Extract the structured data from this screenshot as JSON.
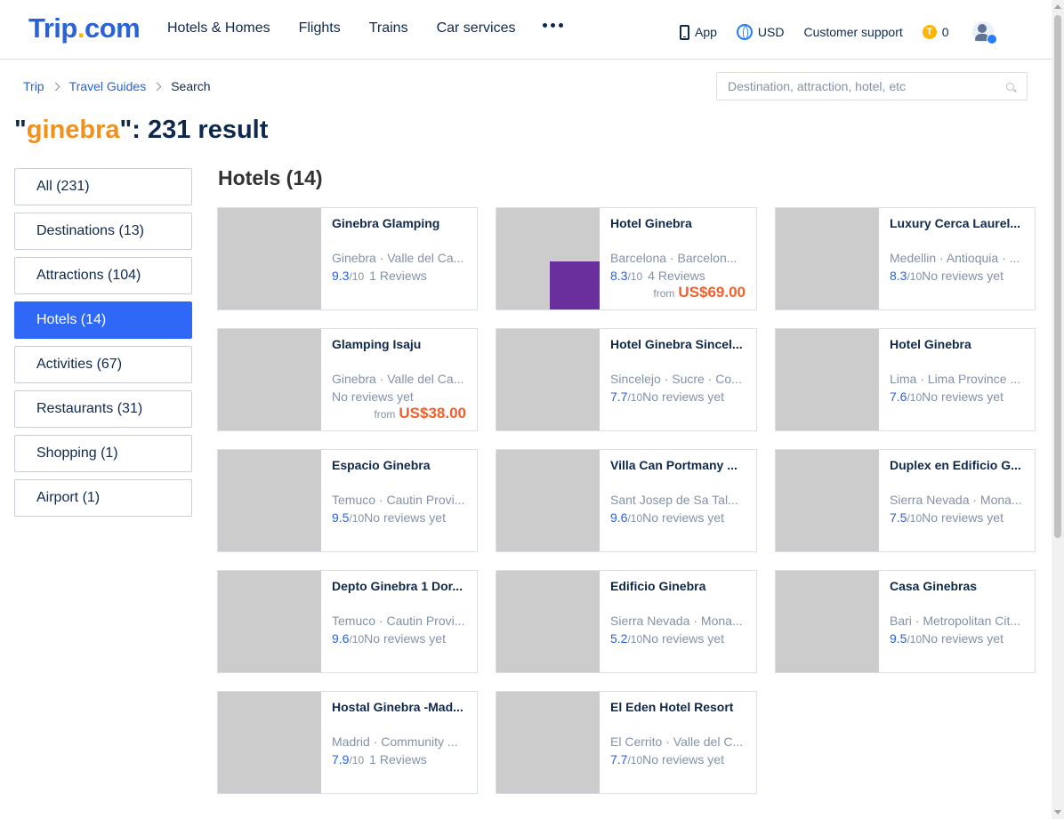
{
  "header": {
    "logo_main": "Trip",
    "logo_dot": ".",
    "logo_tld": "com",
    "nav": [
      "Hotels & Homes",
      "Flights",
      "Trains",
      "Car services"
    ],
    "app_label": "App",
    "currency": "USD",
    "support_label": "Customer support",
    "coins": "0",
    "coin_symbol": "T"
  },
  "breadcrumb": [
    "Trip",
    "Travel Guides",
    "Search"
  ],
  "search": {
    "placeholder": "Destination, attraction, hotel, etc",
    "value": ""
  },
  "results": {
    "open_quote": "\"",
    "keyword": "ginebra",
    "suffix": "\": 231 result"
  },
  "categories": [
    "All (231)",
    "Destinations (13)",
    "Attractions (104)",
    "Hotels (14)",
    "Activities (67)",
    "Restaurants (31)",
    "Shopping (1)",
    "Airport (1)"
  ],
  "active_category": "Hotels (14)",
  "section_title": "Hotels (14)",
  "hotels": [
    {
      "name": "Ginebra Glamping",
      "location": "Ginebra · Valle del Ca...",
      "score": "9.3",
      "outof": "/10",
      "reviews": "1 Reviews",
      "price_from": "",
      "price": ""
    },
    {
      "name": "Hotel Ginebra",
      "location": "Barcelona · Barcelon...",
      "score": "8.3",
      "outof": "/10",
      "reviews": "4 Reviews",
      "price_from": "from",
      "price": "US$69.00"
    },
    {
      "name": "Luxury Cerca Laurel...",
      "location": "Medellin · Antioquia · ...",
      "score": "8.3",
      "outof": "/10",
      "reviews": "No reviews yet",
      "price_from": "",
      "price": ""
    },
    {
      "name": "Glamping Isaju",
      "location": "Ginebra · Valle del Ca...",
      "score": "",
      "outof": "",
      "reviews": "No reviews yet",
      "price_from": "from",
      "price": "US$38.00"
    },
    {
      "name": "Hotel Ginebra Sincel...",
      "location": "Sincelejo · Sucre · Co...",
      "score": "7.7",
      "outof": "/10",
      "reviews": "No reviews yet",
      "price_from": "",
      "price": ""
    },
    {
      "name": "Hotel Ginebra",
      "location": "Lima · Lima Province ...",
      "score": "7.6",
      "outof": "/10",
      "reviews": "No reviews yet",
      "price_from": "",
      "price": ""
    },
    {
      "name": "Espacio Ginebra",
      "location": "Temuco · Cautin Provi...",
      "score": "9.5",
      "outof": "/10",
      "reviews": "No reviews yet",
      "price_from": "",
      "price": ""
    },
    {
      "name": "Villa Can Portmany ...",
      "location": "Sant Josep de Sa Tal...",
      "score": "9.6",
      "outof": "/10",
      "reviews": "No reviews yet",
      "price_from": "",
      "price": ""
    },
    {
      "name": "Duplex en Edificio G...",
      "location": "Sierra Nevada · Mona...",
      "score": "7.5",
      "outof": "/10",
      "reviews": "No reviews yet",
      "price_from": "",
      "price": ""
    },
    {
      "name": "Depto Ginebra 1 Dor...",
      "location": "Temuco · Cautin Provi...",
      "score": "9.6",
      "outof": "/10",
      "reviews": "No reviews yet",
      "price_from": "",
      "price": ""
    },
    {
      "name": "Edificio Ginebra",
      "location": "Sierra Nevada · Mona...",
      "score": "5.2",
      "outof": "/10",
      "reviews": "No reviews yet",
      "price_from": "",
      "price": ""
    },
    {
      "name": "Casa Ginebras",
      "location": "Bari · Metropolitan Cit...",
      "score": "9.5",
      "outof": "/10",
      "reviews": "No reviews yet",
      "price_from": "",
      "price": ""
    },
    {
      "name": "Hostal Ginebra -Mad...",
      "location": "Madrid · Community ...",
      "score": "7.9",
      "outof": "/10",
      "reviews": "1 Reviews",
      "price_from": "",
      "price": ""
    },
    {
      "name": "El Eden Hotel Resort",
      "location": "El Cerrito · Valle del C...",
      "score": "7.7",
      "outof": "/10",
      "reviews": "No reviews yet",
      "price_from": "",
      "price": ""
    }
  ],
  "colors": {
    "brand_blue": "#2962d9",
    "brand_yellow": "#ffb400",
    "active_blue": "#2f67f6",
    "keyword_orange": "#f0901f",
    "price_orange": "#f25f2c",
    "score_blue": "#2962d9"
  },
  "icons": [
    "phone-icon",
    "globe-icon",
    "coin-icon",
    "avatar",
    "search-icon",
    "more-dots-icon",
    "chevron-right-icon"
  ]
}
